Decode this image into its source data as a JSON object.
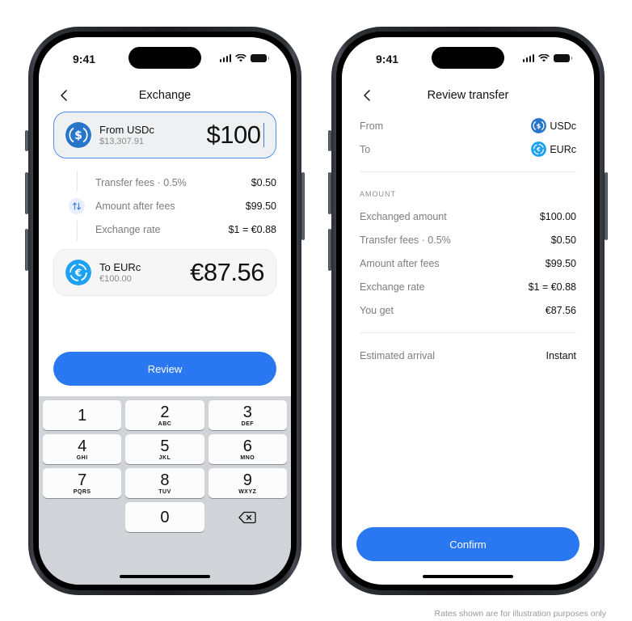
{
  "status_bar": {
    "time": "9:41"
  },
  "exchange_screen": {
    "title": "Exchange",
    "from": {
      "label": "From USDc",
      "balance": "$13,307.91",
      "amount": "$100",
      "coin_icon": "usdc-coin-icon",
      "coin_color": "#2775ca"
    },
    "fees": [
      {
        "label": "Transfer fees · 0.5%",
        "value": "$0.50"
      },
      {
        "label": "Amount after fees",
        "value": "$99.50"
      },
      {
        "label": "Exchange rate",
        "value": "$1 = €0.88"
      }
    ],
    "to": {
      "label": "To EURc",
      "sub": "€100.00",
      "amount": "€87.56",
      "coin_icon": "eurc-coin-icon",
      "coin_color": "#1da1f2"
    },
    "review_button": "Review",
    "keypad": [
      {
        "num": "1",
        "letters": ""
      },
      {
        "num": "2",
        "letters": "ABC"
      },
      {
        "num": "3",
        "letters": "DEF"
      },
      {
        "num": "4",
        "letters": "GHI"
      },
      {
        "num": "5",
        "letters": "JKL"
      },
      {
        "num": "6",
        "letters": "MNO"
      },
      {
        "num": "7",
        "letters": "PQRS"
      },
      {
        "num": "8",
        "letters": "TUV"
      },
      {
        "num": "9",
        "letters": "WXYZ"
      },
      {
        "num": "0",
        "letters": ""
      }
    ]
  },
  "review_screen": {
    "title": "Review transfer",
    "from_label": "From",
    "from_value": "USDc",
    "to_label": "To",
    "to_value": "EURc",
    "section_title": "AMOUNT",
    "rows": [
      {
        "label": "Exchanged amount",
        "value": "$100.00"
      },
      {
        "label": "Transfer fees · 0.5%",
        "value": "$0.50"
      },
      {
        "label": "Amount after fees",
        "value": "$99.50"
      },
      {
        "label": "Exchange rate",
        "value": "$1 = €0.88"
      },
      {
        "label": "You get",
        "value": "€87.56"
      }
    ],
    "arrival_label": "Estimated arrival",
    "arrival_value": "Instant",
    "confirm_button": "Confirm"
  },
  "footnote": "Rates shown are for illustration purposes only",
  "colors": {
    "accent": "#2a77f2",
    "usdc": "#2775ca",
    "eurc": "#1da1f2"
  }
}
